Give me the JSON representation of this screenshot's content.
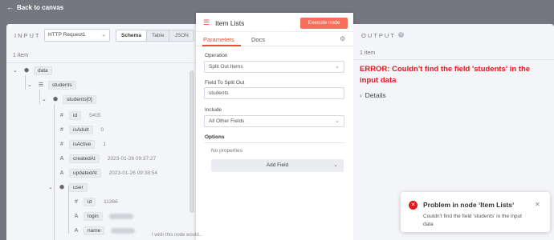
{
  "topbar": {
    "back_label": "Back to canvas"
  },
  "input": {
    "label": "INPUT",
    "node": "HTTP Request1",
    "tabs": [
      "Schema",
      "Table",
      "JSON"
    ],
    "count": "1 item",
    "tree": {
      "data": "data",
      "students": "students",
      "students0": "students[0]",
      "id_key": "id",
      "id_val": "5405",
      "isAdult_key": "isAdult",
      "isAdult_val": "0",
      "isActive_key": "isActive",
      "isActive_val": "1",
      "createdAt_key": "createdAt",
      "createdAt_val": "2023-01-26 09:37:27",
      "updatedAt_key": "updatedAt",
      "updatedAt_val": "2023-01-26 09:38:54",
      "user": "user",
      "user_id_key": "id",
      "user_id_val": "11366",
      "login_key": "login",
      "name_key": "name"
    }
  },
  "node_panel": {
    "title": "Item Lists",
    "execute_label": "Execute node",
    "tabs": [
      "Parameters",
      "Docs"
    ],
    "operation_label": "Operation",
    "operation_value": "Split Out Items",
    "field_label": "Field To Split Out",
    "field_value": "students",
    "include_label": "Include",
    "include_value": "All Other Fields",
    "options_label": "Options",
    "no_props": "No properties",
    "add_field": "Add Field",
    "wish": "I wish this node would..."
  },
  "output": {
    "label": "OUTPUT",
    "count": "1 item",
    "error": "ERROR: Couldn't find the field 'students' in the input data",
    "details": "Details"
  },
  "toast": {
    "title": "Problem in node ‘Item Lists‘",
    "message": "Couldn't find the field 'students' in the input data"
  },
  "colors": {
    "accent": "#ea4b3c",
    "execute": "#f76f5b",
    "error": "#e0191a",
    "canvas": "#75777f"
  }
}
